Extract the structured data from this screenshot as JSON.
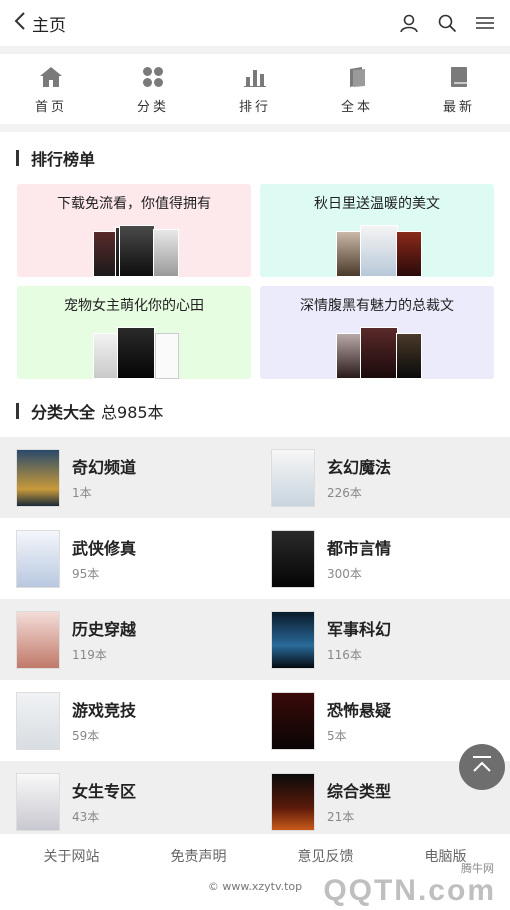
{
  "header": {
    "title": "主页"
  },
  "nav": [
    {
      "label": "首页",
      "icon": "home-icon"
    },
    {
      "label": "分类",
      "icon": "category-icon"
    },
    {
      "label": "排行",
      "icon": "rank-icon"
    },
    {
      "label": "全本",
      "icon": "book-stack-icon"
    },
    {
      "label": "最新",
      "icon": "book-icon"
    }
  ],
  "ranking": {
    "title": "排行榜单",
    "cards": [
      {
        "label": "下载免流看，你值得拥有",
        "bg": "#fde8ec"
      },
      {
        "label": "秋日里送温暖的美文",
        "bg": "#ddfbf3"
      },
      {
        "label": "宠物女主萌化你的心田",
        "bg": "#e6fde1"
      },
      {
        "label": "深情腹黑有魅力的总裁文",
        "bg": "#ebebfc"
      }
    ]
  },
  "categories": {
    "title": "分类大全",
    "total": "总985本",
    "items": [
      {
        "name": "奇幻频道",
        "count": "1本"
      },
      {
        "name": "玄幻魔法",
        "count": "226本"
      },
      {
        "name": "武侠修真",
        "count": "95本"
      },
      {
        "name": "都市言情",
        "count": "300本"
      },
      {
        "name": "历史穿越",
        "count": "119本"
      },
      {
        "name": "军事科幻",
        "count": "116本"
      },
      {
        "name": "游戏竞技",
        "count": "59本"
      },
      {
        "name": "恐怖悬疑",
        "count": "5本"
      },
      {
        "name": "女生专区",
        "count": "43本"
      },
      {
        "name": "综合类型",
        "count": "21本"
      }
    ]
  },
  "footer": {
    "links": [
      "关于网站",
      "免责声明",
      "意见反馈",
      "电脑版"
    ],
    "copyright": "© www.xzytv.top"
  },
  "watermark": {
    "small": "腾牛网",
    "logo": "QQTN.com"
  }
}
